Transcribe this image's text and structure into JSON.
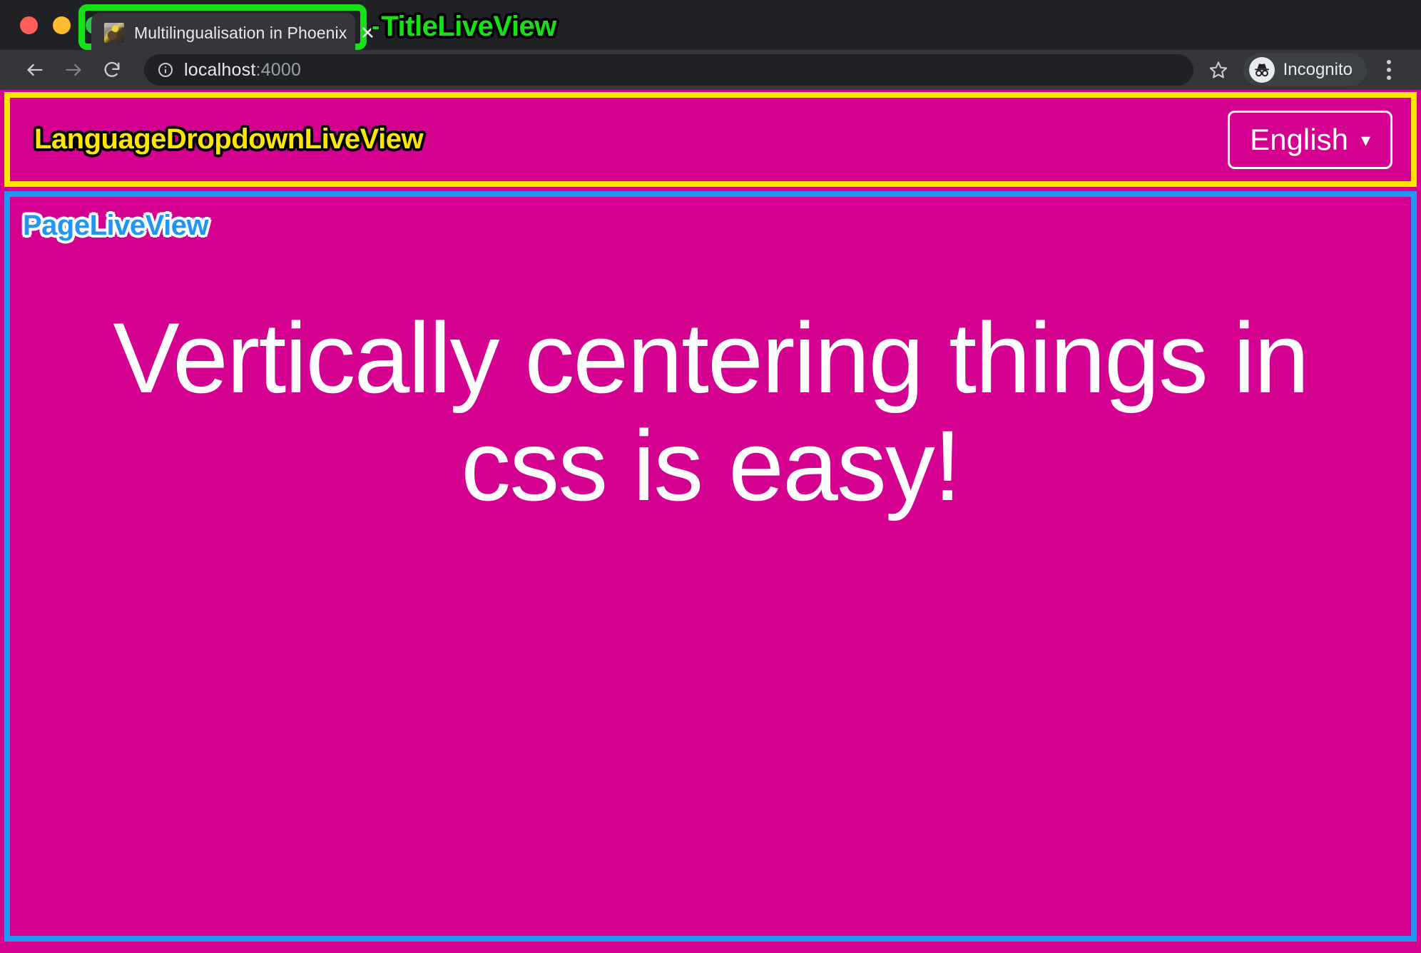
{
  "window": {
    "traffic_lights": [
      "close",
      "minimize",
      "zoom"
    ]
  },
  "tab": {
    "title": "Multilingualisation in Phoenix",
    "close_label": "✕",
    "favicon": "site-favicon"
  },
  "annotations": {
    "title_live_view": {
      "label": "TitleLiveView",
      "dash": "-",
      "color": "#16e016"
    },
    "language_dropdown_live_view": {
      "label": "LanguageDropdownLiveView",
      "color": "#FFE600"
    },
    "page_live_view": {
      "label": "PageLiveView",
      "color": "#2196F3"
    }
  },
  "toolbar": {
    "back_icon": "arrow-left-icon",
    "forward_icon": "arrow-right-icon",
    "reload_icon": "reload-icon",
    "info_icon": "info-circle-icon",
    "url_host": "localhost",
    "url_port": ":4000",
    "bookmark_icon": "star-icon",
    "profile_icon": "incognito-icon",
    "profile_label": "Incognito",
    "menu_icon": "kebab-menu-icon"
  },
  "page": {
    "background_color": "#D4008F",
    "language_button": {
      "label": "English",
      "caret": "▾"
    },
    "heading": "Vertically centering things in css is easy!"
  }
}
